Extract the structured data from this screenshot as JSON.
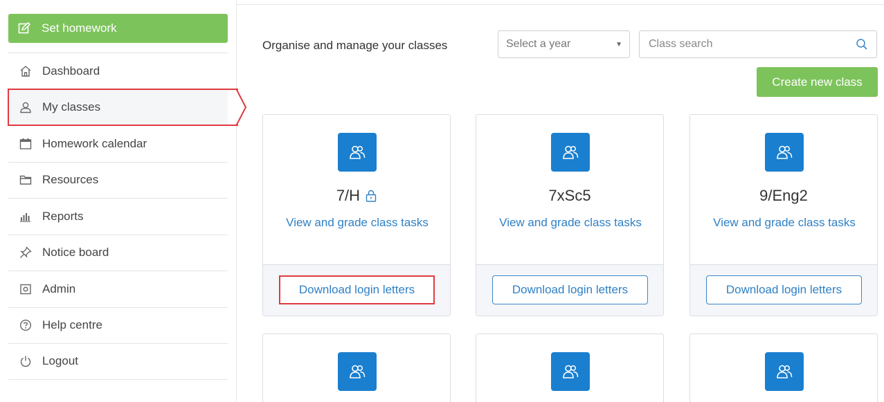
{
  "sidebar": {
    "set_homework": "Set homework",
    "items": [
      {
        "label": "Dashboard",
        "icon": "home-icon"
      },
      {
        "label": "My classes",
        "icon": "user-icon"
      },
      {
        "label": "Homework calendar",
        "icon": "calendar-icon"
      },
      {
        "label": "Resources",
        "icon": "folder-icon"
      },
      {
        "label": "Reports",
        "icon": "bar-chart-icon"
      },
      {
        "label": "Notice board",
        "icon": "pin-icon"
      },
      {
        "label": "Admin",
        "icon": "admin-icon"
      },
      {
        "label": "Help centre",
        "icon": "question-icon"
      },
      {
        "label": "Logout",
        "icon": "power-icon"
      }
    ]
  },
  "main": {
    "heading": "Organise and manage your classes",
    "year_select": "Select a year",
    "search_placeholder": "Class search",
    "create_label": "Create new class",
    "classes": [
      {
        "name": "7/H",
        "link": "View and grade class tasks",
        "download": "Download login letters",
        "locked": true
      },
      {
        "name": "7xSc5",
        "link": "View and grade class tasks",
        "download": "Download login letters"
      },
      {
        "name": "9/Eng2",
        "link": "View and grade class tasks",
        "download": "Download login letters"
      }
    ]
  },
  "colors": {
    "green": "#7dc35b",
    "blue": "#1a7fcf",
    "link": "#2f80c6",
    "highlight": "#e03a3e"
  }
}
